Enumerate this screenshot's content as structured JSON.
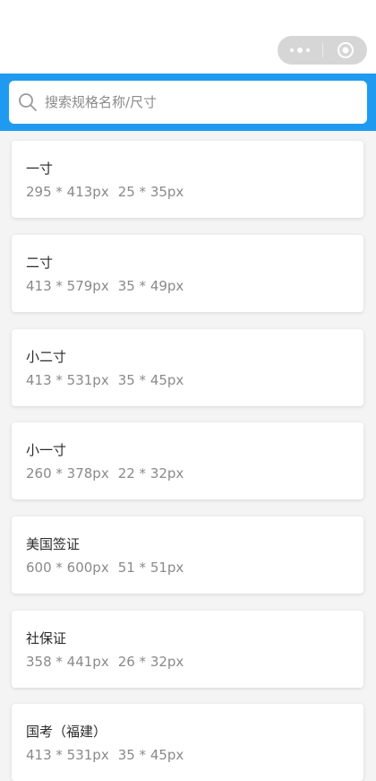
{
  "search": {
    "placeholder": "搜索规格名称/尺寸"
  },
  "sizes": [
    {
      "name": "一寸",
      "pixels": "295 * 413px",
      "mm": "25 * 35px"
    },
    {
      "name": "二寸",
      "pixels": "413 * 579px",
      "mm": "35 * 49px"
    },
    {
      "name": "小二寸",
      "pixels": "413 * 531px",
      "mm": "35 * 45px"
    },
    {
      "name": "小一寸",
      "pixels": "260 * 378px",
      "mm": "22 * 32px"
    },
    {
      "name": "美国签证",
      "pixels": "600 * 600px",
      "mm": "51 * 51px"
    },
    {
      "name": "社保证",
      "pixels": "358 * 441px",
      "mm": "26 * 32px"
    },
    {
      "name": "国考（福建）",
      "pixels": "413 * 531px",
      "mm": "35 * 45px"
    }
  ],
  "colors": {
    "accent": "#1e9bf0",
    "background": "#f4f4f4"
  },
  "icons": {
    "menu": "more-dots-icon",
    "close": "target-close-icon",
    "search": "search-icon"
  }
}
